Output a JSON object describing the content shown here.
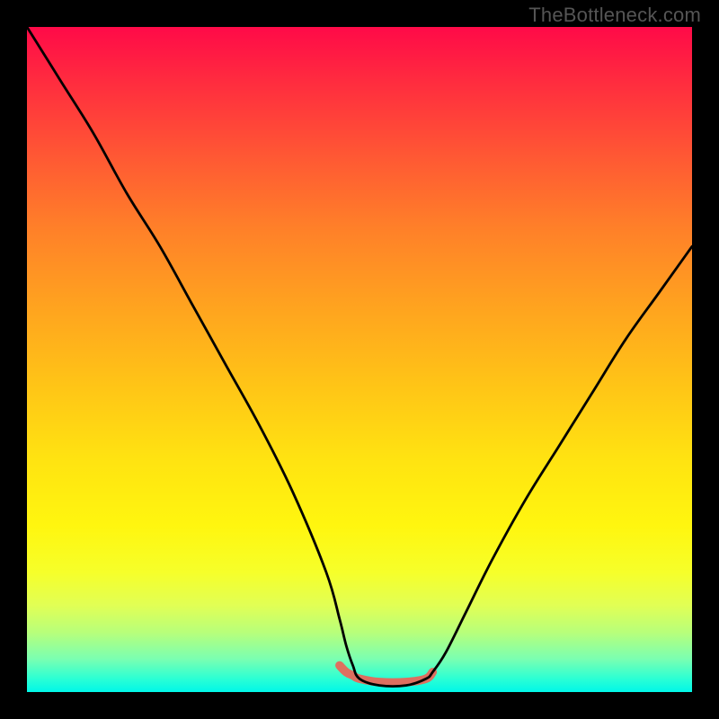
{
  "watermark": "TheBottleneck.com",
  "chart_data": {
    "type": "line",
    "title": "",
    "xlabel": "",
    "ylabel": "",
    "xlim": [
      0,
      100
    ],
    "ylim": [
      0,
      100
    ],
    "grid": false,
    "series": [
      {
        "name": "bottleneck-curve",
        "x": [
          0,
          5,
          10,
          15,
          20,
          25,
          30,
          35,
          40,
          45,
          47,
          48,
          49,
          50,
          53,
          57,
          60,
          61,
          63,
          66,
          70,
          75,
          80,
          85,
          90,
          95,
          100
        ],
        "values": [
          100,
          92,
          84,
          75,
          67,
          58,
          49,
          40,
          30,
          18,
          11,
          7,
          4,
          2,
          1,
          1,
          2,
          3,
          6,
          12,
          20,
          29,
          37,
          45,
          53,
          60,
          67
        ]
      },
      {
        "name": "optimal-band-highlight",
        "x": [
          47,
          48,
          49,
          50,
          53,
          57,
          60,
          61
        ],
        "values": [
          4,
          3,
          2.5,
          2,
          1.5,
          1.5,
          2,
          3
        ]
      }
    ],
    "colors": {
      "gradient_top": "#ff0a48",
      "gradient_mid": "#ffc217",
      "gradient_bottom": "#00f7e8",
      "curve": "#000000",
      "highlight": "#e36a5c"
    }
  }
}
